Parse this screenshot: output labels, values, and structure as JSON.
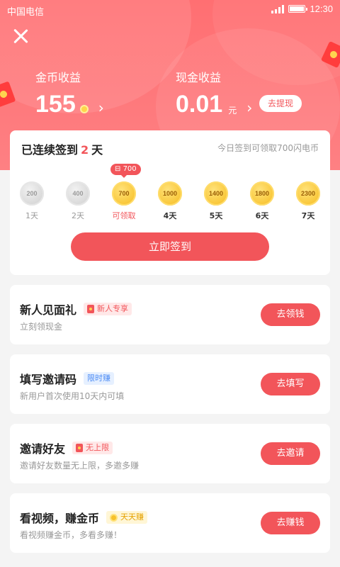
{
  "status_bar": {
    "carrier": "中国电信",
    "time": "12:30"
  },
  "header": {
    "close_icon": "close-icon",
    "coin_earnings": {
      "label": "金币收益",
      "value": "155"
    },
    "cash_earnings": {
      "label": "现金收益",
      "value": "0.01",
      "unit": "元"
    },
    "withdraw_label": "去提现",
    "colors": {
      "header_start": "#ff6f72",
      "header_end": "#fe8083",
      "accent": "#f2555a"
    }
  },
  "signin": {
    "title_prefix": "已连续签到",
    "days": "2",
    "title_suffix": "天",
    "hint": "今日签到可领取700闪电币",
    "tooltip": "700",
    "days_list": [
      {
        "coin": "200",
        "label": "1天",
        "state": "done"
      },
      {
        "coin": "400",
        "label": "2天",
        "state": "done"
      },
      {
        "coin": "700",
        "label": "可领取",
        "state": "today"
      },
      {
        "coin": "1000",
        "label": "4天",
        "state": "future"
      },
      {
        "coin": "1400",
        "label": "5天",
        "state": "future"
      },
      {
        "coin": "1800",
        "label": "6天",
        "state": "future"
      },
      {
        "coin": "2300",
        "label": "7天",
        "state": "future"
      }
    ],
    "button": "立即签到"
  },
  "tasks": [
    {
      "title": "新人见面礼",
      "badge": "新人专享",
      "badge_style": "red",
      "badge_icon": "red-packet-icon",
      "desc": "立刻领现金",
      "button": "去领钱"
    },
    {
      "title": "填写邀请码",
      "badge": "限时赚",
      "badge_style": "blue",
      "badge_icon": "",
      "desc": "新用户首次使用10天内可填",
      "button": "去填写"
    },
    {
      "title": "邀请好友",
      "badge": "无上限",
      "badge_style": "red",
      "badge_icon": "red-packet-icon",
      "desc": "邀请好友数量无上限，多邀多赚",
      "button": "去邀请"
    },
    {
      "title": "看视频，赚金币",
      "badge": "天天赚",
      "badge_style": "yellow",
      "badge_icon": "coin-icon",
      "desc": "看视频赚金币，多看多赚！",
      "button": "去赚钱"
    }
  ]
}
